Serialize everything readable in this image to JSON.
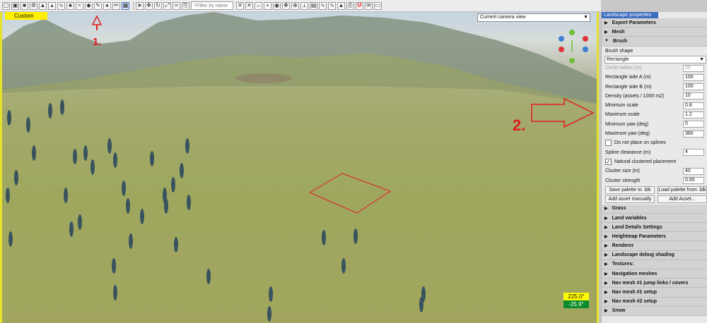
{
  "toolbar": {
    "icons": [
      "new-file-icon",
      "open-file-icon",
      "save-icon",
      "settings-icon",
      "terrain-icon",
      "terrain-icon-2",
      "curve-icon",
      "tree-icon",
      "water-icon",
      "droplet-icon",
      "brush-icon",
      "grass-icon",
      "pencil-icon",
      "landscape-panel-icon",
      "select-arrow-icon",
      "move-icon",
      "rotate-icon",
      "scale-icon",
      "snap-icon",
      "paste-icon"
    ],
    "filter_placeholder": "Filter by name",
    "right_icons": [
      "hide-icon",
      "hide-icon-2",
      "ruler-icon",
      "plus-icon",
      "gizmo-icon",
      "move-icon-2",
      "axis-icon",
      "road-icon",
      "blue-icon",
      "spline-icon",
      "spline-icon-2",
      "red-icon",
      "camera-icon",
      "magnet-m-icon",
      "mail-icon",
      "display-icon"
    ]
  },
  "viewport": {
    "label": "Custom",
    "camera_select": "Current camera view",
    "readout_top": "225.0°",
    "readout_bottom": "-25.9°",
    "annotation_1": "1.",
    "annotation_2": "2."
  },
  "panel": {
    "tab": "Landscape properties",
    "sections_top": [
      {
        "label": "Export Parameters"
      },
      {
        "label": "Mesh"
      },
      {
        "label": "Brush"
      }
    ],
    "brush": {
      "shape_label": "Brush shape",
      "shape_value": "Rectangle",
      "fields": [
        {
          "label": "Circle radius (m)",
          "value": "20",
          "disabled": true
        },
        {
          "label": "Rectangle side A (m)",
          "value": "100"
        },
        {
          "label": "Rectangle side B (m)",
          "value": "100"
        },
        {
          "label": "Density (assets / 1000 m2)",
          "value": "10"
        },
        {
          "label": "Minimum scale",
          "value": "0.8"
        },
        {
          "label": "Maximum scale",
          "value": "1.2"
        },
        {
          "label": "Minimum yaw (deg)",
          "value": "0"
        },
        {
          "label": "Maximum yaw (deg)",
          "value": "360"
        }
      ],
      "do_not_place_label": "Do not place on splines",
      "spline_clearance_label": "Spline clearance (m)",
      "spline_clearance_value": "4",
      "natural_clustered_label": "Natural clustered placement",
      "cluster_size_label": "Cluster size (m)",
      "cluster_size_value": "40",
      "cluster_strength_label": "Cluster strength",
      "cluster_strength_value": "0.65",
      "save_palette": "Save palette to .blk",
      "load_palette": "Load palette from .blk",
      "add_manual": "Add asset manually",
      "add_asset": "Add Asset..."
    },
    "sections_bottom": [
      {
        "label": "Grass"
      },
      {
        "label": "Land variables"
      },
      {
        "label": "Land Details Settings"
      },
      {
        "label": "Heightmap Parameters"
      },
      {
        "label": "Renderer"
      },
      {
        "label": "Landscape debug shading"
      },
      {
        "label": "Textures:"
      },
      {
        "label": "Navigation meshes"
      },
      {
        "label": "Nav mesh #1 jump links / covers"
      },
      {
        "label": "Nav mesh #1 setup"
      },
      {
        "label": "Nav mesh #2 setup"
      },
      {
        "label": "Snow"
      }
    ]
  },
  "scene_colors": {
    "mountain": "#7f8f7a",
    "grass": "#9fa75f",
    "tree": "#38535e",
    "brush_outline": "#e02020"
  }
}
